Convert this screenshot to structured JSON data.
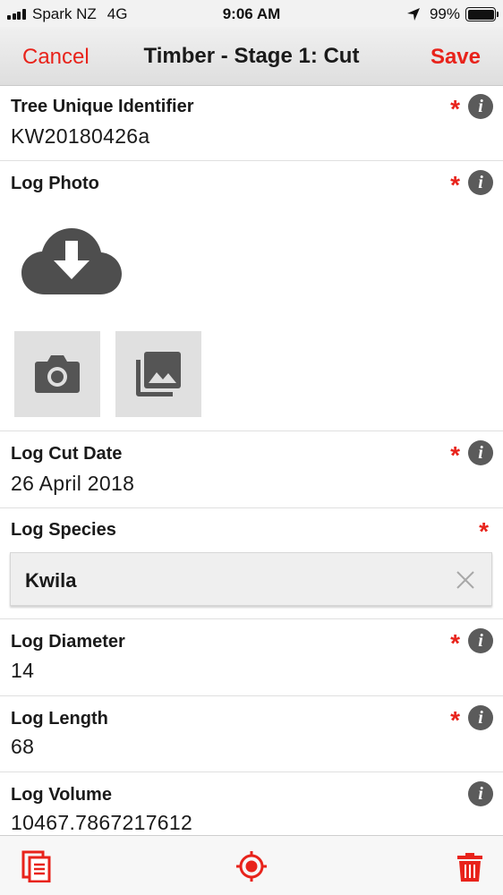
{
  "status_bar": {
    "carrier": "Spark NZ",
    "network": "4G",
    "time": "9:06 AM",
    "battery": "99%"
  },
  "nav": {
    "cancel_label": "Cancel",
    "title": "Timber - Stage 1: Cut",
    "save_label": "Save"
  },
  "form": {
    "tree_id": {
      "label": "Tree Unique Identifier",
      "value": "KW20180426a",
      "required": "*"
    },
    "log_photo": {
      "label": "Log Photo",
      "required": "*"
    },
    "cut_date": {
      "label": "Log Cut Date",
      "value": "26 April 2018",
      "required": "*"
    },
    "species": {
      "label": "Log Species",
      "value": "Kwila",
      "required": "*"
    },
    "diameter": {
      "label": "Log Diameter",
      "value": "14",
      "required": "*"
    },
    "length": {
      "label": "Log Length",
      "value": "68",
      "required": "*"
    },
    "volume": {
      "label": "Log Volume",
      "value": "10467.7867217612"
    }
  },
  "info_glyph": "i",
  "colors": {
    "accent": "#e8231b",
    "info_bg": "#5b5b5b",
    "icon_gray": "#555555"
  },
  "icons": {
    "photo_placeholder": "cloud-download-icon",
    "camera": "camera-icon",
    "gallery": "photo-library-icon",
    "copy": "copy-document-icon",
    "location": "target-location-icon",
    "delete": "trash-icon"
  }
}
